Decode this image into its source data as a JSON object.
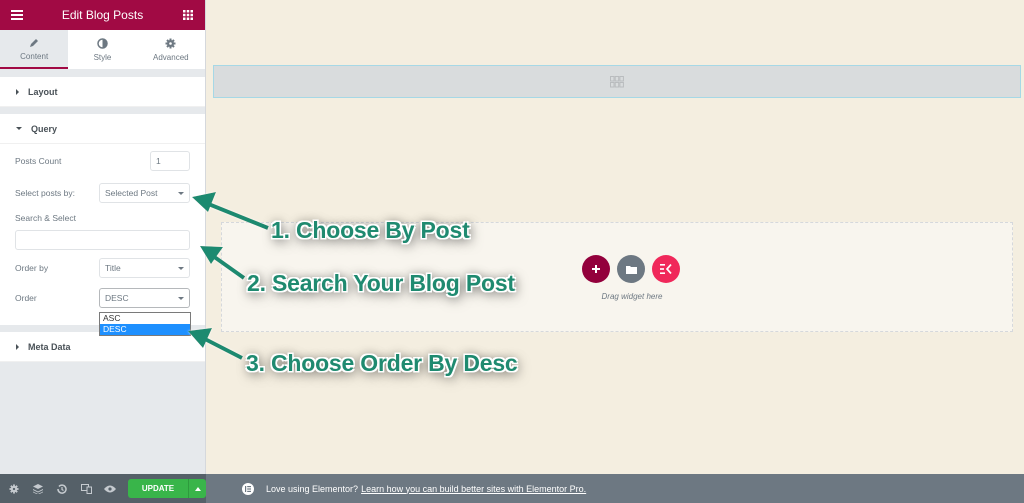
{
  "panel": {
    "title": "Edit Blog Posts",
    "tabs": [
      {
        "label": "Content",
        "icon": "pencil-icon",
        "active": true
      },
      {
        "label": "Style",
        "icon": "contrast-icon",
        "active": false
      },
      {
        "label": "Advanced",
        "icon": "gear-icon",
        "active": false
      }
    ],
    "sections": {
      "layout": "Layout",
      "query": "Query",
      "meta": "Meta Data"
    },
    "query": {
      "posts_count_label": "Posts Count",
      "posts_count_value": "1",
      "select_by_label": "Select posts by:",
      "select_by_value": "Selected Post",
      "search_label": "Search & Select",
      "search_value": "",
      "order_by_label": "Order by",
      "order_by_value": "Title",
      "order_label": "Order",
      "order_value": "DESC",
      "order_options": [
        "ASC",
        "DESC"
      ],
      "order_selected_option": "DESC"
    }
  },
  "footer": {
    "update_label": "UPDATE",
    "promo_text": "Love using Elementor?",
    "promo_link": "Learn how you can build better sites with Elementor Pro."
  },
  "canvas": {
    "drag_text": "Drag widget here"
  },
  "annotations": [
    "1. Choose By Post",
    "2. Search Your Blog Post",
    "3. Choose Order By Desc"
  ],
  "colors": {
    "brand": "#a10a44",
    "update_green": "#39b54a",
    "annotation_green": "#1f8a70",
    "dropdown_selected": "#1e90ff",
    "elementor_kit_pink": "#f0285a"
  }
}
